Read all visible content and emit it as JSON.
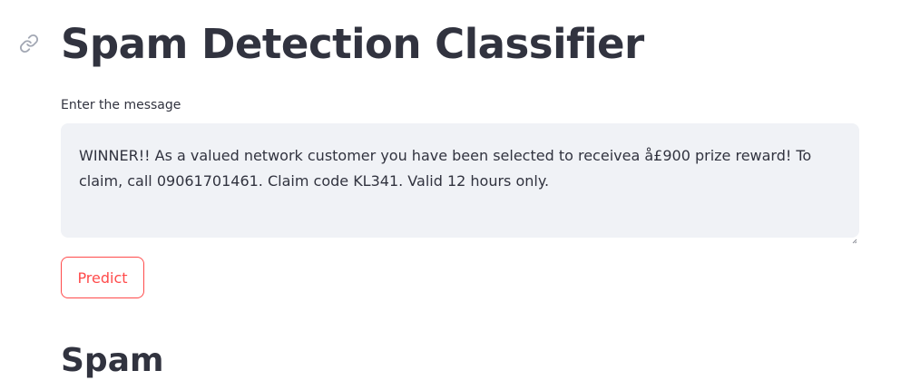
{
  "page": {
    "title": "Spam Detection Classifier"
  },
  "form": {
    "label": "Enter the message",
    "message_value": "WINNER!! As a valued network customer you have been selected to receivea å£900 prize reward! To claim, call 09061701461. Claim code KL341. Valid 12 hours only.",
    "predict_label": "Predict"
  },
  "result": {
    "label": "Spam"
  },
  "icons": {
    "anchor": "link-icon",
    "resize": "resize-handle-icon"
  },
  "colors": {
    "text": "#31333f",
    "accent": "#ff4b4b",
    "input_bg": "#f0f2f6"
  }
}
